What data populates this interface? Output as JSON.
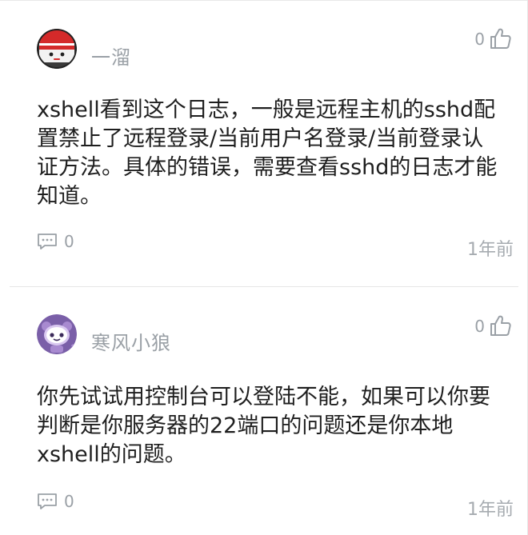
{
  "comments": [
    {
      "username": "一溜",
      "avatar": "ninja-avatar",
      "likes": "0",
      "text": "xshell看到这个日志，一般是远程主机的sshd配置禁止了远程登录/当前用户名登录/当前登录认证方法。具体的错误，需要查看sshd的日志才能知道。",
      "replies": "0",
      "time": "1年前"
    },
    {
      "username": "寒风小狼",
      "avatar": "robot-avatar",
      "likes": "0",
      "text": "你先试试用控制台可以登陆不能，如果可以你要判断是你服务器的22端口的问题还是你本地xshell的问题。",
      "replies": "0",
      "time": "1年前"
    }
  ],
  "icons": {
    "like": "thumbs-up-icon",
    "reply": "comment-icon"
  },
  "colors": {
    "meta_gray": "#9aa0a6",
    "text": "#1e1e1e",
    "divider": "#e6e6e6"
  }
}
